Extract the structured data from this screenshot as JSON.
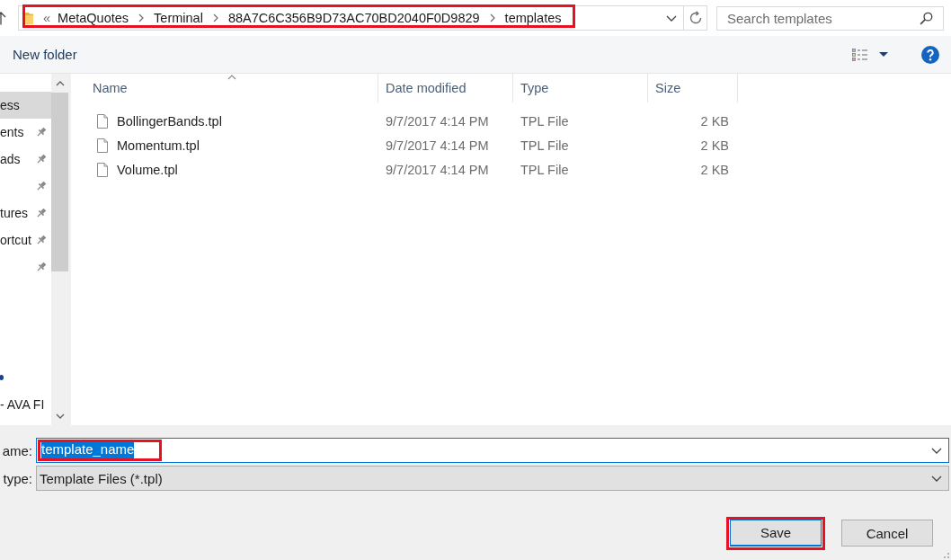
{
  "address_bar": {
    "overflow_marker": "«",
    "path": [
      "MetaQuotes",
      "Terminal",
      "88A7C6C356B9D73AC70BD2040F0D9829",
      "templates"
    ],
    "highlighted": true
  },
  "search": {
    "placeholder": "Search templates"
  },
  "toolbar": {
    "new_folder": "New folder"
  },
  "navigation": {
    "groups": [
      {
        "items": [
          {
            "kind": "label",
            "label": "ess",
            "pinned": false,
            "selected": true
          },
          {
            "kind": "label",
            "label": "ents",
            "pinned": true,
            "selected": false
          },
          {
            "kind": "label",
            "label": "ads",
            "pinned": true,
            "selected": false
          },
          {
            "kind": "label",
            "pinned": true,
            "selected": false
          },
          {
            "kind": "label",
            "label": "tures",
            "pinned": true,
            "selected": false
          },
          {
            "kind": "label",
            "label": "ortcut",
            "pinned": true,
            "selected": false
          },
          {
            "kind": "label",
            "pinned": true,
            "selected": false
          }
        ]
      },
      {
        "items": [
          {
            "kind": "icon",
            "pinned": false,
            "selected": false
          },
          {
            "kind": "label",
            "label": "- AVA FI",
            "pinned": false,
            "selected": false
          }
        ]
      }
    ]
  },
  "files": {
    "columns": [
      {
        "label": "Name",
        "sorted": true
      },
      {
        "label": "Date modified",
        "sorted": false
      },
      {
        "label": "Type",
        "sorted": false
      },
      {
        "label": "Size",
        "sorted": false
      }
    ],
    "rows": [
      {
        "name": "BollingerBands.tpl",
        "date_modified": "9/7/2017 4:14 PM",
        "type": "TPL File",
        "size": "2 KB",
        "selected": false
      },
      {
        "name": "Momentum.tpl",
        "date_modified": "9/7/2017 4:14 PM",
        "type": "TPL File",
        "size": "2 KB",
        "selected": false
      },
      {
        "name": "Volume.tpl",
        "date_modified": "9/7/2017 4:14 PM",
        "type": "TPL File",
        "size": "2 KB",
        "selected": false
      }
    ]
  },
  "file_name": {
    "label": "ame:",
    "value": "template_name",
    "text_selected": true,
    "highlighted": true
  },
  "save_as_type": {
    "label": "type:",
    "value": "Template Files (*.tpl)"
  },
  "buttons": [
    {
      "label": "Save",
      "focused": true,
      "highlighted": true
    },
    {
      "label": "Cancel",
      "focused": false,
      "highlighted": false
    }
  ]
}
